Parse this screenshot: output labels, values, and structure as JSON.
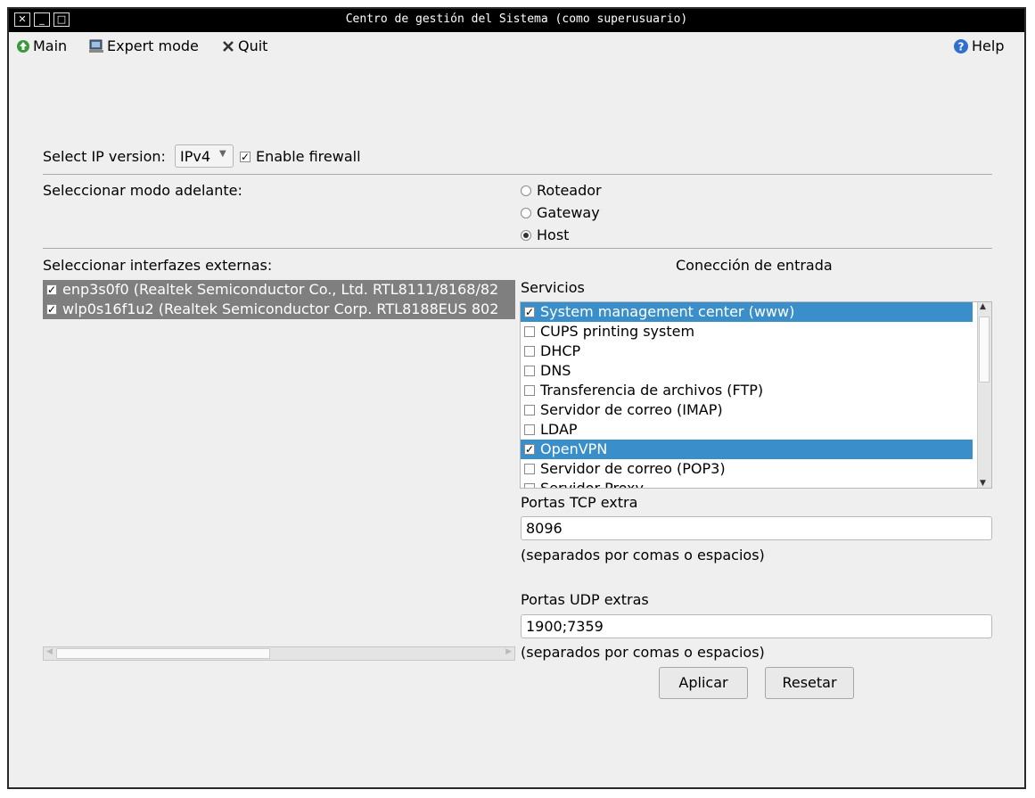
{
  "window": {
    "title": "Centro de gestión del Sistema (como superusuario)",
    "close_glyph": "✕",
    "min_glyph": "_",
    "max_glyph": "□"
  },
  "menu": {
    "main": "Main",
    "expert": "Expert mode",
    "quit": "Quit",
    "help": "Help"
  },
  "ip": {
    "label": "Select IP version:",
    "value": "IPv4",
    "firewall_label": "Enable firewall",
    "firewall_checked": true
  },
  "forward": {
    "label": "Seleccionar modo adelante:",
    "options": [
      {
        "label": "Roteador",
        "selected": false
      },
      {
        "label": "Gateway",
        "selected": false
      },
      {
        "label": "Host",
        "selected": true
      }
    ]
  },
  "interfaces": {
    "label": "Seleccionar interfazes externas:",
    "items": [
      {
        "label": "enp3s0f0 (Realtek Semiconductor Co., Ltd. RTL8111/8168/82",
        "checked": true
      },
      {
        "label": "wlp0s16f1u2 (Realtek Semiconductor Corp. RTL8188EUS 802",
        "checked": true
      }
    ]
  },
  "incoming": {
    "title": "Conección de entrada",
    "services_label": "Servicios",
    "services": [
      {
        "label": "System management center (www)",
        "checked": true,
        "selected": true
      },
      {
        "label": "CUPS printing system",
        "checked": false,
        "selected": false
      },
      {
        "label": "DHCP",
        "checked": false,
        "selected": false
      },
      {
        "label": "DNS",
        "checked": false,
        "selected": false
      },
      {
        "label": "Transferencia de archivos (FTP)",
        "checked": false,
        "selected": false
      },
      {
        "label": "Servidor de correo (IMAP)",
        "checked": false,
        "selected": false
      },
      {
        "label": "LDAP",
        "checked": false,
        "selected": false
      },
      {
        "label": "OpenVPN",
        "checked": true,
        "selected": true
      },
      {
        "label": "Servidor de correo (POP3)",
        "checked": false,
        "selected": false
      },
      {
        "label": "Servidor Proxy",
        "checked": false,
        "selected": false
      }
    ],
    "tcp_label": "Portas TCP extra",
    "tcp_value": "8096",
    "tcp_hint": "(separados por comas o espacios)",
    "udp_label": "Portas UDP extras",
    "udp_value": "1900;7359",
    "udp_hint": "(separados por comas o espacios)"
  },
  "buttons": {
    "apply": "Aplicar",
    "reset": "Resetar"
  },
  "colors": {
    "selection": "#3a8fcb",
    "titlebar": "#000000"
  }
}
